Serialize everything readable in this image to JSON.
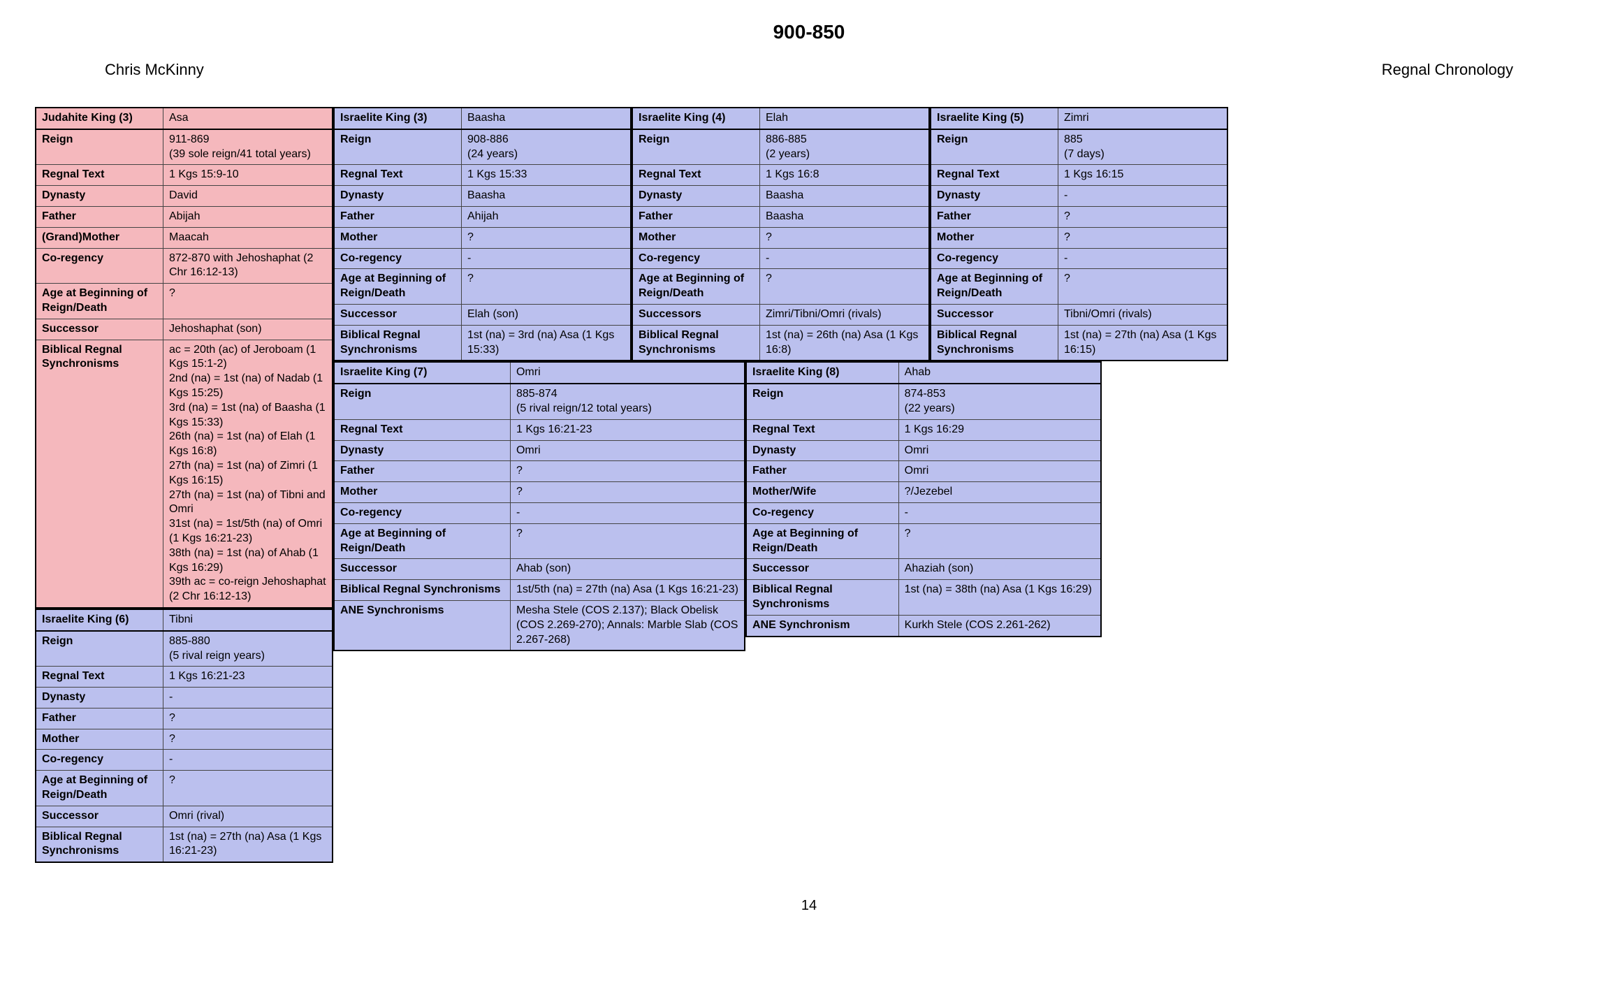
{
  "header": {
    "title": "900-850",
    "author_left": "Chris McKinny",
    "author_right": "Regnal Chronology"
  },
  "footer": {
    "page": "14"
  },
  "judah3": {
    "title": "Judahite King (3)",
    "name": "Asa",
    "reign": "911-869\n(39 sole reign/41 total years)",
    "regnal_text": "1 Kgs 15:9-10",
    "dynasty": "David",
    "father": "Abijah",
    "grandmother_label": "(Grand)Mother",
    "grandmother": "Maacah",
    "coregency": "872-870  with Jehoshaphat (2 Chr 16:12-13)",
    "age_lbl": "Age at Beginning of Reign/Death",
    "age": "?",
    "successor": "Jehoshaphat (son)",
    "sync_lbl": "Biblical Regnal Synchronisms",
    "sync": "ac = 20th (ac) of Jeroboam (1 Kgs 15:1-2)\n2nd (na) = 1st (na) of Nadab (1 Kgs 15:25)\n3rd (na) = 1st (na) of Baasha (1 Kgs 15:33)\n26th (na) = 1st (na) of Elah (1 Kgs 16:8)\n27th (na) = 1st (na) of Zimri (1 Kgs 16:15)\n27th (na) = 1st (na) of Tibni and Omri\n31st (na) = 1st/5th (na) of Omri (1 Kgs 16:21-23)\n38th (na) = 1st (na) of Ahab (1 Kgs 16:29)\n39th ac = co-reign Jehoshaphat (2 Chr 16:12-13)"
  },
  "israel6": {
    "title": "Israelite King (6)",
    "name": "Tibni",
    "reign": "885-880\n(5 rival reign years)",
    "regnal_text": "1 Kgs 16:21-23",
    "dynasty": "-",
    "father": "?",
    "mother": "?",
    "coregency": "-",
    "age_lbl": "Age at Beginning of Reign/Death",
    "age": "?",
    "successor": "Omri (rival)",
    "sync_lbl": "Biblical Regnal Synchronisms",
    "sync": "1st (na) = 27th (na) Asa (1 Kgs 16:21-23)"
  },
  "israel3": {
    "title": "Israelite King (3)",
    "name": "Baasha",
    "reign": "908-886\n(24 years)",
    "regnal_text": "1 Kgs 15:33",
    "dynasty": "Baasha",
    "father": "Ahijah",
    "mother": "?",
    "coregency": "-",
    "age_lbl": "Age at Beginning of Reign/Death",
    "age": "?",
    "successor": "Elah (son)",
    "sync_lbl": "Biblical Regnal Synchronisms",
    "sync": "1st (na) = 3rd (na) Asa (1 Kgs 15:33)"
  },
  "israel4": {
    "title": "Israelite King (4)",
    "name": "Elah",
    "reign": "886-885\n(2 years)",
    "regnal_text": "1 Kgs 16:8",
    "dynasty": "Baasha",
    "father": "Baasha",
    "mother": "?",
    "coregency": "-",
    "age_lbl": "Age at Beginning of Reign/Death",
    "age": "?",
    "successors_lbl": "Successors",
    "successor": "Zimri/Tibni/Omri (rivals)",
    "sync_lbl": "Biblical Regnal Synchronisms",
    "sync": "1st (na) = 26th (na) Asa (1 Kgs 16:8)"
  },
  "israel5": {
    "title": "Israelite King (5)",
    "name": "Zimri",
    "reign": "885\n(7 days)",
    "regnal_text": "1 Kgs 16:15",
    "dynasty": "-",
    "father": "?",
    "mother": "?",
    "coregency": "-",
    "age_lbl": "Age at Beginning of Reign/Death",
    "age": "?",
    "successor": "Tibni/Omri (rivals)",
    "sync_lbl": "Biblical Regnal Synchronisms",
    "sync": "1st (na) = 27th (na) Asa (1 Kgs 16:15)"
  },
  "israel7": {
    "title": "Israelite King (7)",
    "name": "Omri",
    "reign": "885-874\n(5 rival reign/12 total years)",
    "regnal_text": "1 Kgs 16:21-23",
    "dynasty": "Omri",
    "father": "?",
    "mother": "?",
    "coregency": "-",
    "age_lbl": "Age at Beginning of Reign/Death",
    "age": "?",
    "successor": "Ahab (son)",
    "sync_lbl": "Biblical Regnal Synchronisms",
    "sync": "1st/5th (na) = 27th (na) Asa (1 Kgs 16:21-23)",
    "ane_lbl": "ANE Synchronisms",
    "ane": "Mesha Stele (COS 2.137); Black Obelisk (COS 2.269-270); Annals: Marble Slab (COS 2.267-268)"
  },
  "israel8": {
    "title": "Israelite King (8)",
    "name": "Ahab",
    "reign": "874-853\n(22 years)",
    "regnal_text": "1 Kgs 16:29",
    "dynasty": "Omri",
    "father": "Omri",
    "motherwife_lbl": "Mother/Wife",
    "motherwife": "?/Jezebel",
    "coregency": "-",
    "age_lbl": "Age at Beginning of Reign/Death",
    "age": "?",
    "successor": "Ahaziah (son)",
    "sync_lbl": "Biblical Regnal Synchronisms",
    "sync": "1st (na) = 38th (na) Asa (1 Kgs 16:29)",
    "ane_lbl": "ANE Synchronism",
    "ane": "Kurkh Stele (COS 2.261-262)"
  },
  "labels": {
    "reign": "Reign",
    "regnal_text": "Regnal Text",
    "dynasty": "Dynasty",
    "father": "Father",
    "mother": "Mother",
    "coregency": "Co-regency",
    "successor": "Successor"
  }
}
